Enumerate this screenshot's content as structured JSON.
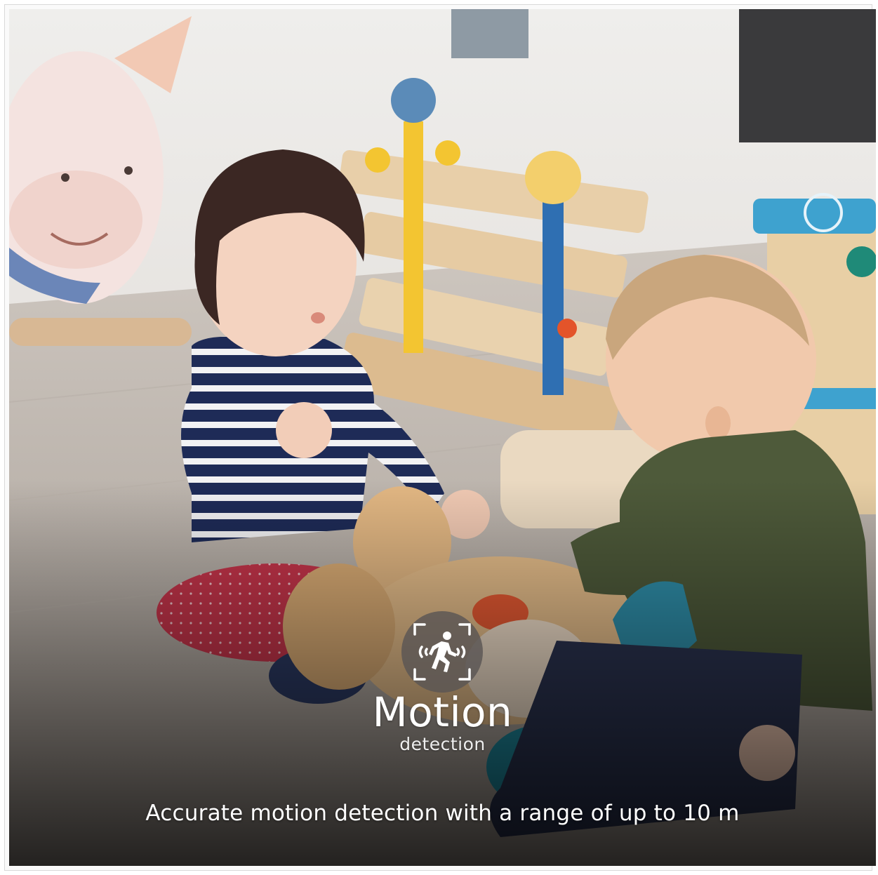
{
  "feature": {
    "title": "Motion",
    "subtitle": "detection",
    "caption": "Accurate motion detection with a range of up to 10 m",
    "icon": "motion-sensor-icon"
  },
  "colors": {
    "badge_background": "#5a5654",
    "text": "#ffffff"
  }
}
